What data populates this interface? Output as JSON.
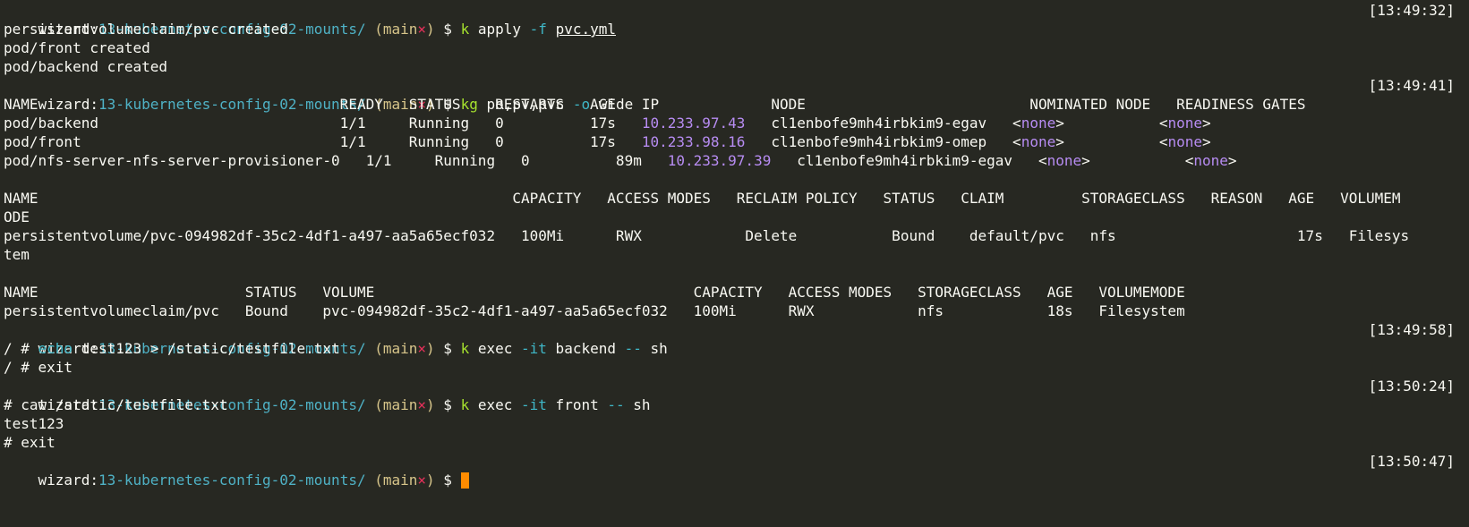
{
  "colors": {
    "background": "#272822",
    "foreground": "#f8f8f2",
    "path": "#4fb2c6",
    "git_branch": "#d7c58a",
    "git_dirty": "#e5305a",
    "command": "#a6e22e",
    "flag": "#3fb7c7",
    "ip": "#b78cf2",
    "cursor": "#ff8c00"
  },
  "prompt": {
    "user": "wizard",
    "colon": ":",
    "path": "13-kubernetes-config-02-mounts/",
    "branch_open": " (",
    "branch": "main",
    "dirty": "×",
    "branch_close": ")",
    "dollar": " $ "
  },
  "timestamps": [
    "[13:49:32]",
    "[13:49:41]",
    "[13:49:58]",
    "[13:50:24]",
    "[13:50:47]"
  ],
  "cmd1": {
    "k": "k",
    "rest1": " apply ",
    "flag": "-f",
    "sp": " ",
    "file": "pvc.yml"
  },
  "apply_output": [
    "persistentvolumeclaim/pvc created",
    "pod/front created",
    "pod/backend created"
  ],
  "cmd2": {
    "k": "kg",
    "rest1": " po,pv,pvc ",
    "flag": "-o",
    "rest2": " wide"
  },
  "pods": {
    "header": "NAME                                   READY   STATUS    RESTARTS   AGE   IP             NODE                          NOMINATED NODE   READINESS GATES",
    "rows": [
      {
        "pre": "pod/backend                            1/1     Running   0          17s   ",
        "ip": "10.233.97.43",
        "mid": "   cl1enbofe9mh4irbkim9-egav   ",
        "nominated": "<none>",
        "gap": "           ",
        "readiness": "<none>"
      },
      {
        "pre": "pod/front                              1/1     Running   0          17s   ",
        "ip": "10.233.98.16",
        "mid": "   cl1enbofe9mh4irbkim9-omep   ",
        "nominated": "<none>",
        "gap": "           ",
        "readiness": "<none>"
      },
      {
        "pre": "pod/nfs-server-nfs-server-provisioner-0   1/1     Running   0          89m   ",
        "ip": "10.233.97.39",
        "mid": "   cl1enbofe9mh4irbkim9-egav   ",
        "nominated": "<none>",
        "gap": "           ",
        "readiness": "<none>"
      }
    ]
  },
  "pv": {
    "header1": "NAME                                                       CAPACITY   ACCESS MODES   RECLAIM POLICY   STATUS   CLAIM         STORAGECLASS   REASON   AGE   VOLUMEM",
    "header2": "ODE",
    "row1": "persistentvolume/pvc-094982df-35c2-4df1-a497-aa5a65ecf032   100Mi      RWX            Delete           Bound    default/pvc   nfs                     17s   Filesys",
    "row2": "tem"
  },
  "pvc": {
    "header": "NAME                        STATUS   VOLUME                                     CAPACITY   ACCESS MODES   STORAGECLASS   AGE   VOLUMEMODE",
    "row": "persistentvolumeclaim/pvc   Bound    pvc-094982df-35c2-4df1-a497-aa5a65ecf032   100Mi      RWX            nfs            18s   Filesystem"
  },
  "cmd3": {
    "k": "k",
    "rest1": " exec ",
    "flag": "-it",
    "rest2": " backend ",
    "dashes": "--",
    "rest3": " sh"
  },
  "backend_shell": {
    "prompt": "/ # ",
    "echo": "echo",
    "echo_rest": " test123 > /static/testfile.txt",
    "exit": "/ # exit"
  },
  "cmd4": {
    "k": "k",
    "rest1": " exec ",
    "flag": "-it",
    "rest2": " front ",
    "dashes": "--",
    "rest3": " sh"
  },
  "front_shell": {
    "cat": "# cat /static/testfile.txt",
    "output": "test123",
    "exit": "# exit"
  }
}
